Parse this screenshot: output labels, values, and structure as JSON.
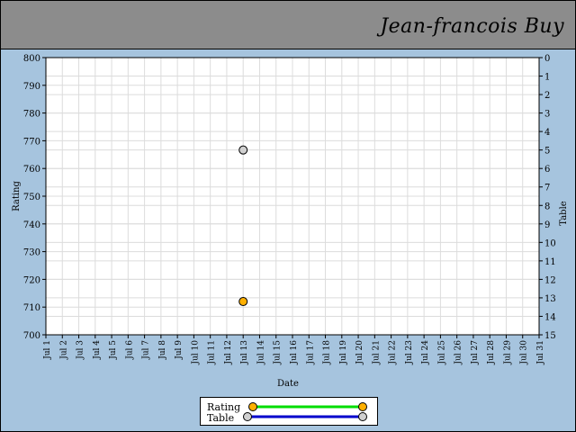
{
  "header": {
    "player_name": "Jean-francois Buy"
  },
  "colors": {
    "background": "#a6c4de",
    "header": "#8c8c8c",
    "plot_background": "#ffffff",
    "grid": "#dcdcdc",
    "rating_line": "#00dd00",
    "rating_marker": "#ffb000",
    "table_line": "#0000cc",
    "table_marker": "#d0d0d0"
  },
  "chart_data": {
    "type": "scatter",
    "xlabel": "Date",
    "ylabel": "Rating",
    "y2label": "Table",
    "categories": [
      "Jul 1",
      "Jul 2",
      "Jul 3",
      "Jul 4",
      "Jul 5",
      "Jul 6",
      "Jul 7",
      "Jul 8",
      "Jul 9",
      "Jul 10",
      "Jul 11",
      "Jul 12",
      "Jul 13",
      "Jul 14",
      "Jul 15",
      "Jul 16",
      "Jul 17",
      "Jul 18",
      "Jul 19",
      "Jul 20",
      "Jul 21",
      "Jul 22",
      "Jul 23",
      "Jul 24",
      "Jul 25",
      "Jul 26",
      "Jul 27",
      "Jul 28",
      "Jul 29",
      "Jul 30",
      "Jul 31"
    ],
    "ylim": [
      700,
      800
    ],
    "y_ticks": [
      700,
      710,
      720,
      730,
      740,
      750,
      760,
      770,
      780,
      790,
      800
    ],
    "y2lim": [
      0,
      15
    ],
    "y2_inverted": true,
    "y2_ticks": [
      0,
      1,
      2,
      3,
      4,
      5,
      6,
      7,
      8,
      9,
      10,
      11,
      12,
      13,
      14,
      15
    ],
    "grid": true,
    "legend_position": "bottom",
    "series": [
      {
        "name": "Rating",
        "axis": "left",
        "points": [
          {
            "x": "Jul 13",
            "y": 712
          }
        ]
      },
      {
        "name": "Table",
        "axis": "right",
        "points": [
          {
            "x": "Jul 13",
            "y": 5
          }
        ]
      }
    ]
  }
}
